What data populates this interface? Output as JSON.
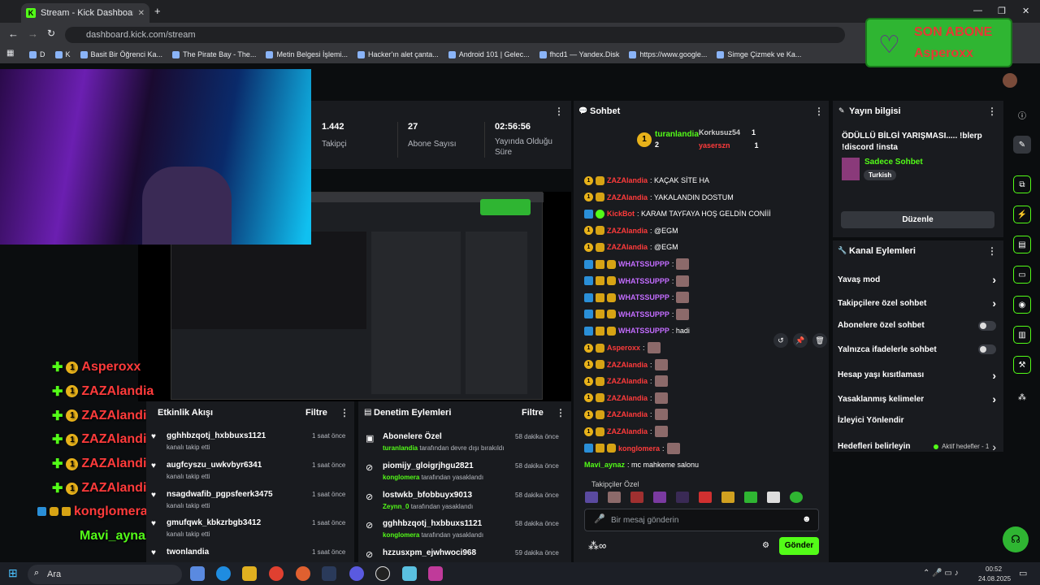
{
  "browser": {
    "tab_title": "Stream - Kick Dashboard",
    "url": "dashboard.kick.com/stream",
    "bookmarks": [
      "D",
      "K",
      "Basit Bir Öğrenci Ka...",
      "The Pirate Bay - The...",
      "Metin Belgesi İşlemi...",
      "Hacker'ın alet çanta...",
      "Android 101 | Gelec...",
      "fhcd1 — Yandex.Disk",
      "https://www.google...",
      "Simge Çizmek ve Ka..."
    ]
  },
  "overlay": {
    "title": "SON ABONE",
    "name": "Asperoxx"
  },
  "stats": [
    {
      "value": "1.442",
      "label": "Takipçi"
    },
    {
      "value": "27",
      "label": "Abone Sayısı"
    },
    {
      "value": "02:56:56",
      "label": "Yayında Olduğu Süre"
    }
  ],
  "chat": {
    "title": "Sohbet",
    "top_gifters": [
      {
        "name": "turanlandia",
        "count": "2"
      },
      {
        "name": "Korkusuz54",
        "count": "1"
      },
      {
        "name": "yaserszn",
        "count": "1"
      }
    ],
    "messages": [
      {
        "user": "ZAZAlandia",
        "text": ": KAÇAK SİTE HA",
        "color": "red"
      },
      {
        "user": "ZAZAlandia",
        "text": ": YAKALANDIN DOSTUM",
        "color": "red"
      },
      {
        "user": "KickBot",
        "text": ": KARAM TAYFAYA HOŞ GELDİN CONİİİ",
        "color": "red"
      },
      {
        "user": "ZAZAlandia",
        "text": ": @EGM",
        "color": "red"
      },
      {
        "user": "ZAZAlandia",
        "text": ": @EGM",
        "color": "red"
      },
      {
        "user": "WHATSSUPPP",
        "text": ":",
        "color": "pur"
      },
      {
        "user": "WHATSSUPPP",
        "text": ":",
        "color": "pur"
      },
      {
        "user": "WHATSSUPPP",
        "text": ":",
        "color": "pur"
      },
      {
        "user": "WHATSSUPPP",
        "text": ":",
        "color": "pur"
      },
      {
        "user": "WHATSSUPPP",
        "text": ": hadi",
        "color": "pur"
      },
      {
        "user": "Asperoxx",
        "text": ":",
        "color": "red"
      },
      {
        "user": "ZAZAlandia",
        "text": ":",
        "color": "red"
      },
      {
        "user": "ZAZAlandia",
        "text": ":",
        "color": "red"
      },
      {
        "user": "ZAZAlandia",
        "text": ":",
        "color": "red"
      },
      {
        "user": "ZAZAlandia",
        "text": ":",
        "color": "red"
      },
      {
        "user": "ZAZAlandia",
        "text": ":",
        "color": "red"
      },
      {
        "user": "konglomera",
        "text": ":",
        "color": "red"
      },
      {
        "user": "Mavi_aynaz",
        "text": ": mc mahkeme salonu",
        "color": "grn"
      }
    ],
    "followers_only": "Takipçiler Özel",
    "input_placeholder": "Bir mesaj gönderin",
    "send": "Gönder"
  },
  "stream_info": {
    "title": "Yayın bilgisi",
    "desc": "ÖDÜLLÜ BİLGİ YARIŞMASI..... !blerp !discord !insta",
    "category": "Sadece Sohbet",
    "tag": "Turkish",
    "edit": "Düzenle"
  },
  "channel_actions": {
    "title": "Kanal Eylemleri",
    "items": [
      {
        "label": "Yavaş mod",
        "kind": "arrow"
      },
      {
        "label": "Takipçilere özel sohbet",
        "kind": "arrow"
      },
      {
        "label": "Abonelere özel sohbet",
        "kind": "toggle"
      },
      {
        "label": "Yalnızca ifadelerle sohbet",
        "kind": "toggle"
      },
      {
        "label": "Hesap yaşı kısıtlaması",
        "kind": "arrow"
      },
      {
        "label": "Yasaklanmış kelimeler",
        "kind": "arrow"
      },
      {
        "label": "İzleyici Yönlendir",
        "kind": "none"
      },
      {
        "label": "Hedefleri belirleyin",
        "kind": "arrow"
      }
    ],
    "goal_status": "Aktif hedefler - 1"
  },
  "activity": {
    "title": "Etkinlik Akışı",
    "filter": "Filtre",
    "items": [
      {
        "name": "gghhbzqotj_hxbbuxs1121",
        "sub": "kanalı takip etti",
        "time": "1 saat önce"
      },
      {
        "name": "augfcyszu_uwkvbyr6341",
        "sub": "kanalı takip etti",
        "time": "1 saat önce"
      },
      {
        "name": "nsagdwafib_pgpsfeerk3475",
        "sub": "kanalı takip etti",
        "time": "1 saat önce"
      },
      {
        "name": "gmufqwk_kbkzrbgb3412",
        "sub": "kanalı takip etti",
        "time": "1 saat önce"
      },
      {
        "name": "twonlandia",
        "sub": "",
        "time": "1 saat önce"
      }
    ]
  },
  "moderation": {
    "title": "Denetim Eylemleri",
    "filter": "Filtre",
    "items": [
      {
        "name": "Abonelere Özel",
        "by": "turanlandia",
        "sub": "tarafından devre dışı bırakıldı",
        "time": "58 dakika önce"
      },
      {
        "name": "piomijy_gloigrjhgu2821",
        "by": "konglomera",
        "sub": "tarafından yasaklandı",
        "time": "58 dakika önce"
      },
      {
        "name": "lostwkb_bfobbuyx9013",
        "by": "Zeynn_0",
        "sub": "tarafından yasaklandı",
        "time": "58 dakika önce"
      },
      {
        "name": "gghhbzqotj_hxbbuxs1121",
        "by": "konglomera",
        "sub": "tarafından yasaklandı",
        "time": "58 dakika önce"
      },
      {
        "name": "hzzusxpm_ejwhwoci968",
        "by": "",
        "sub": "",
        "time": "59 dakika önce"
      }
    ]
  },
  "overlay_chat": [
    {
      "user": "Asperoxx",
      "text": ""
    },
    {
      "user": "ZAZAlandia",
      "text": ""
    },
    {
      "user": "ZAZAlandia",
      "text": ""
    },
    {
      "user": "ZAZAlandia",
      "text": ""
    },
    {
      "user": "ZAZAlandia",
      "text": ""
    },
    {
      "user": "ZAZAlandia",
      "text": ""
    },
    {
      "user": "konglomera",
      "text": ""
    },
    {
      "user": "Mavi_aynaz",
      "text": "mc mahkeme salonu"
    }
  ],
  "taskbar": {
    "search": "Ara",
    "time": "00:52",
    "date": "24.08.2025"
  }
}
